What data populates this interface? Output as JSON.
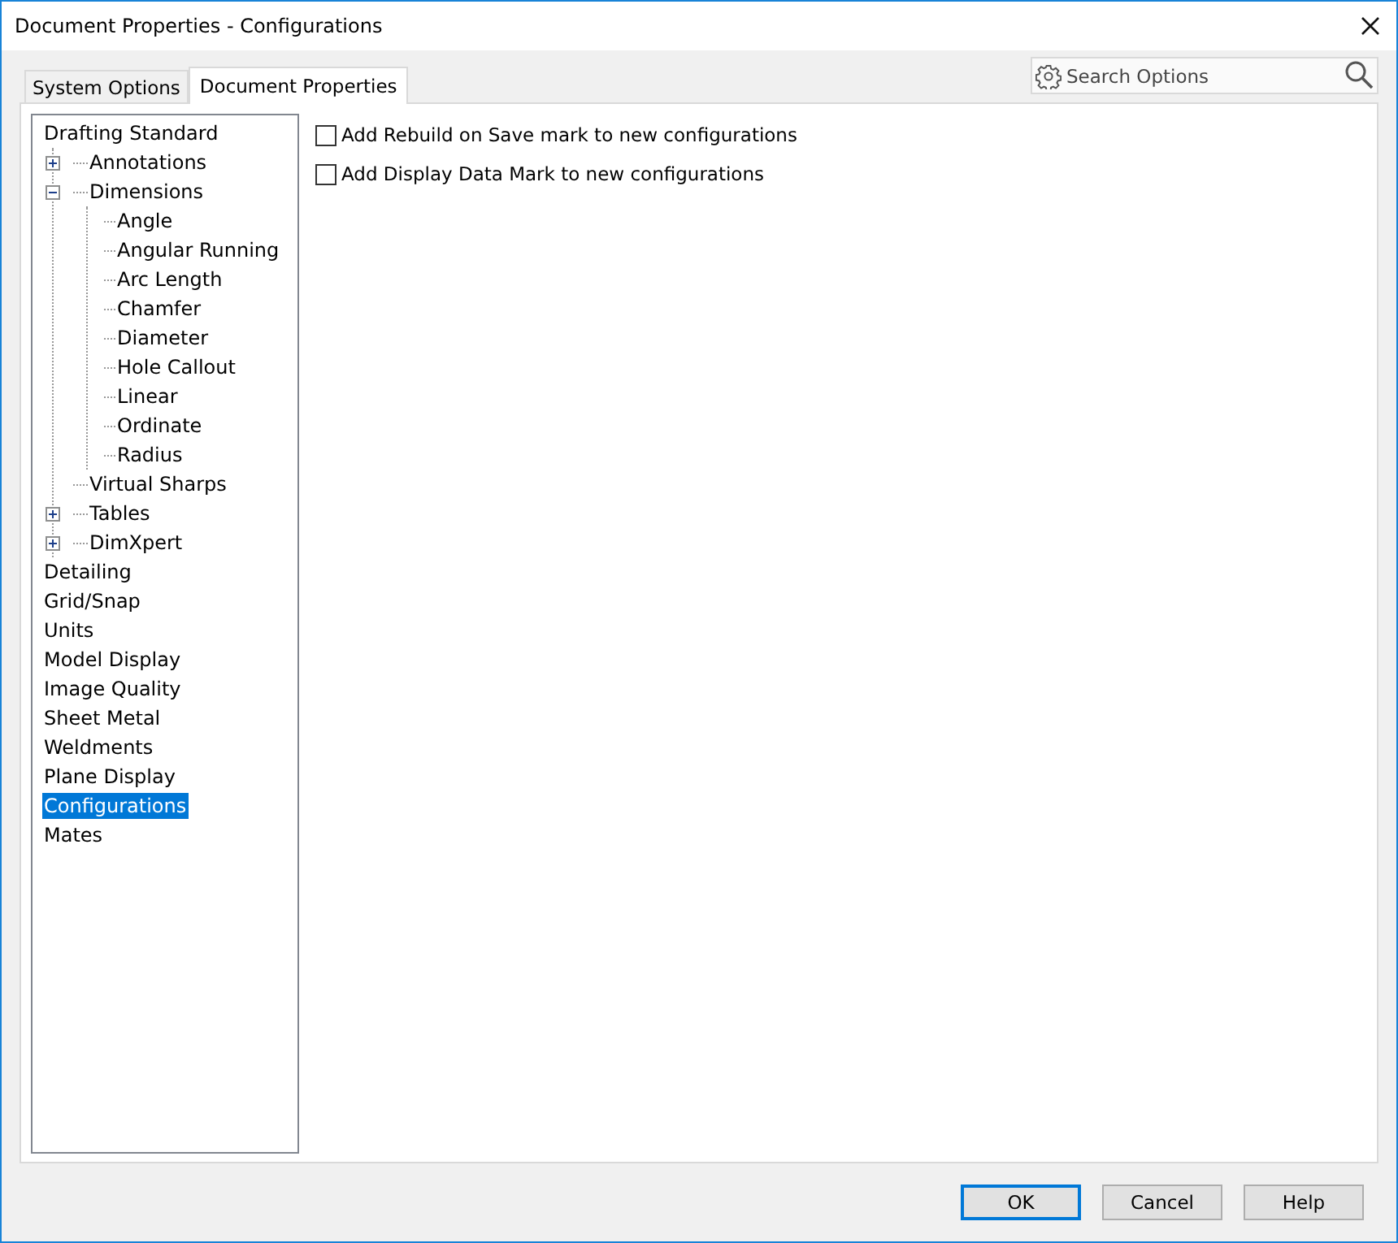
{
  "window": {
    "title": "Document Properties - Configurations"
  },
  "tabs": [
    {
      "label": "System Options",
      "selected": false
    },
    {
      "label": "Document Properties",
      "selected": true
    }
  ],
  "search": {
    "placeholder": "Search Options"
  },
  "tree": [
    {
      "label": "Drafting Standard",
      "selected": false,
      "children": [
        {
          "label": "Annotations",
          "expanded": false,
          "selected": false
        },
        {
          "label": "Dimensions",
          "expanded": true,
          "selected": false,
          "children": [
            {
              "label": "Angle",
              "selected": false
            },
            {
              "label": "Angular Running",
              "selected": false
            },
            {
              "label": "Arc Length",
              "selected": false
            },
            {
              "label": "Chamfer",
              "selected": false
            },
            {
              "label": "Diameter",
              "selected": false
            },
            {
              "label": "Hole Callout",
              "selected": false
            },
            {
              "label": "Linear",
              "selected": false
            },
            {
              "label": "Ordinate",
              "selected": false
            },
            {
              "label": "Radius",
              "selected": false
            }
          ]
        },
        {
          "label": "Virtual Sharps",
          "selected": false
        },
        {
          "label": "Tables",
          "expanded": false,
          "selected": false
        },
        {
          "label": "DimXpert",
          "expanded": false,
          "selected": false
        }
      ]
    },
    {
      "label": "Detailing",
      "selected": false
    },
    {
      "label": "Grid/Snap",
      "selected": false
    },
    {
      "label": "Units",
      "selected": false
    },
    {
      "label": "Model Display",
      "selected": false
    },
    {
      "label": "Image Quality",
      "selected": false
    },
    {
      "label": "Sheet Metal",
      "selected": false
    },
    {
      "label": "Weldments",
      "selected": false
    },
    {
      "label": "Plane Display",
      "selected": false
    },
    {
      "label": "Configurations",
      "selected": true
    },
    {
      "label": "Mates",
      "selected": false
    }
  ],
  "options": [
    {
      "label": "Add Rebuild on Save mark to new configurations",
      "checked": false
    },
    {
      "label": "Add Display Data Mark to new configurations",
      "checked": false
    }
  ],
  "buttons": [
    {
      "label": "OK",
      "default": true
    },
    {
      "label": "Cancel",
      "default": false
    },
    {
      "label": "Help",
      "default": false
    }
  ]
}
